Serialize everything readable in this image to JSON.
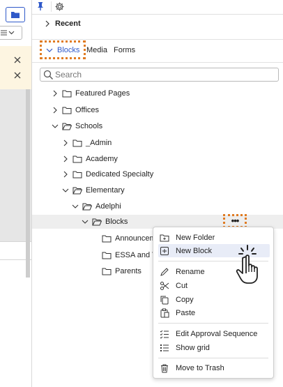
{
  "recent": {
    "label": "Recent"
  },
  "tabs": [
    {
      "label": "Blocks",
      "active": true
    },
    {
      "label": "Media"
    },
    {
      "label": "Forms"
    }
  ],
  "search": {
    "placeholder": "Search",
    "value": ""
  },
  "tree": [
    {
      "label": "Featured Pages"
    },
    {
      "label": "Offices"
    },
    {
      "label": "Schools"
    },
    {
      "label": "_Admin"
    },
    {
      "label": "Academy"
    },
    {
      "label": "Dedicated Specialty"
    },
    {
      "label": "Elementary"
    },
    {
      "label": "Adelphi"
    },
    {
      "label": "Blocks"
    },
    {
      "label": "Announcem"
    },
    {
      "label": "ESSA and T"
    },
    {
      "label": "Parents"
    }
  ],
  "more_button": {
    "label": "•••"
  },
  "context_menu": {
    "items": [
      {
        "label": "New Folder",
        "icon": "new-folder-icon"
      },
      {
        "label": "New Block",
        "icon": "new-block-icon"
      },
      {
        "label": "Rename",
        "icon": "pencil-icon"
      },
      {
        "label": "Cut",
        "icon": "scissors-icon"
      },
      {
        "label": "Copy",
        "icon": "copy-icon"
      },
      {
        "label": "Paste",
        "icon": "paste-icon"
      },
      {
        "label": "Edit Approval Sequence",
        "icon": "approval-sequence-icon"
      },
      {
        "label": "Show grid",
        "icon": "grid-list-icon"
      },
      {
        "label": "Move to Trash",
        "icon": "trash-icon"
      }
    ]
  },
  "colors": {
    "accent": "#2f59c9",
    "highlight_outline": "#e07b22",
    "notice_bg": "#fdf5e1",
    "selected_row_bg": "#eeeeee",
    "menu_hover_bg": "#e8ecf7"
  }
}
